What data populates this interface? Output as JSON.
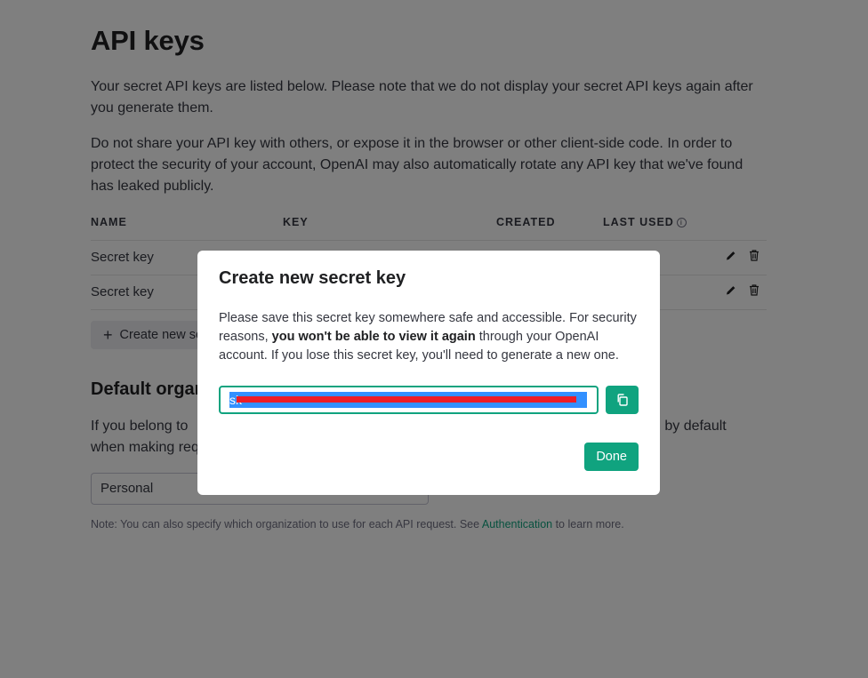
{
  "page": {
    "title": "API keys",
    "intro_1": "Your secret API keys are listed below. Please note that we do not display your secret API keys again after you generate them.",
    "intro_2": "Do not share your API key with others, or expose it in the browser or other client-side code. In order to protect the security of your account, OpenAI may also automatically rotate any API key that we've found has leaked publicly."
  },
  "table": {
    "headers": {
      "name": "NAME",
      "key": "KEY",
      "created": "CREATED",
      "last_used": "LAST USED"
    },
    "rows": [
      {
        "name": "Secret key"
      },
      {
        "name": "Secret key"
      }
    ]
  },
  "create_button": {
    "label": "Create new se"
  },
  "default_org": {
    "title": "Default organ",
    "text": "If you belong to",
    "text_2": "when making req",
    "text_right": "d by default",
    "selected": "Personal",
    "note_prefix": "Note: You can also specify which organization to use for each API request. See ",
    "note_link": "Authentication",
    "note_suffix": " to learn more."
  },
  "modal": {
    "title": "Create new secret key",
    "body_1": "Please save this secret key somewhere safe and accessible. For security reasons, ",
    "body_bold": "you won't be able to view it again",
    "body_2": " through your OpenAI account. If you lose this secret key, you'll need to generate a new one.",
    "key_value": "sk-",
    "done_label": "Done"
  },
  "colors": {
    "accent": "#10a37f",
    "selection": "#3390ff",
    "redaction": "#ee1c25"
  },
  "icons": {
    "edit": "pencil-icon",
    "delete": "trash-icon",
    "copy": "copy-icon",
    "info": "info-icon",
    "add": "plus-icon"
  }
}
